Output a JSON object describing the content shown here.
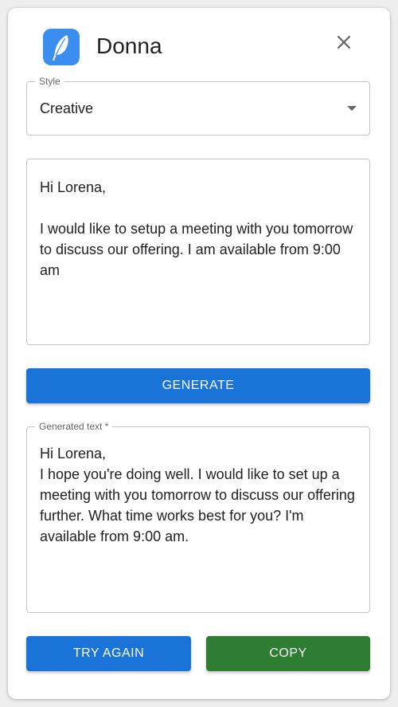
{
  "header": {
    "app_name": "Donna",
    "logo_icon": "feather-logo-icon",
    "close_icon": "close-icon"
  },
  "style_select": {
    "label": "Style",
    "value": "Creative"
  },
  "input": {
    "text": "Hi Lorena,\n\nI would like to setup a meeting with you tomorrow to discuss our offering. I am available from 9:00 am"
  },
  "actions": {
    "generate_label": "GENERATE",
    "try_again_label": "TRY AGAIN",
    "copy_label": "COPY"
  },
  "output": {
    "label": "Generated text *",
    "text": "Hi Lorena,\nI hope you're doing well. I would like to set up a meeting with you tomorrow to discuss our offering further. What time works best for you? I'm available from 9:00 am."
  },
  "colors": {
    "primary": "#1a73d6",
    "success": "#2e7d32",
    "logo": "#3b8ef0"
  }
}
